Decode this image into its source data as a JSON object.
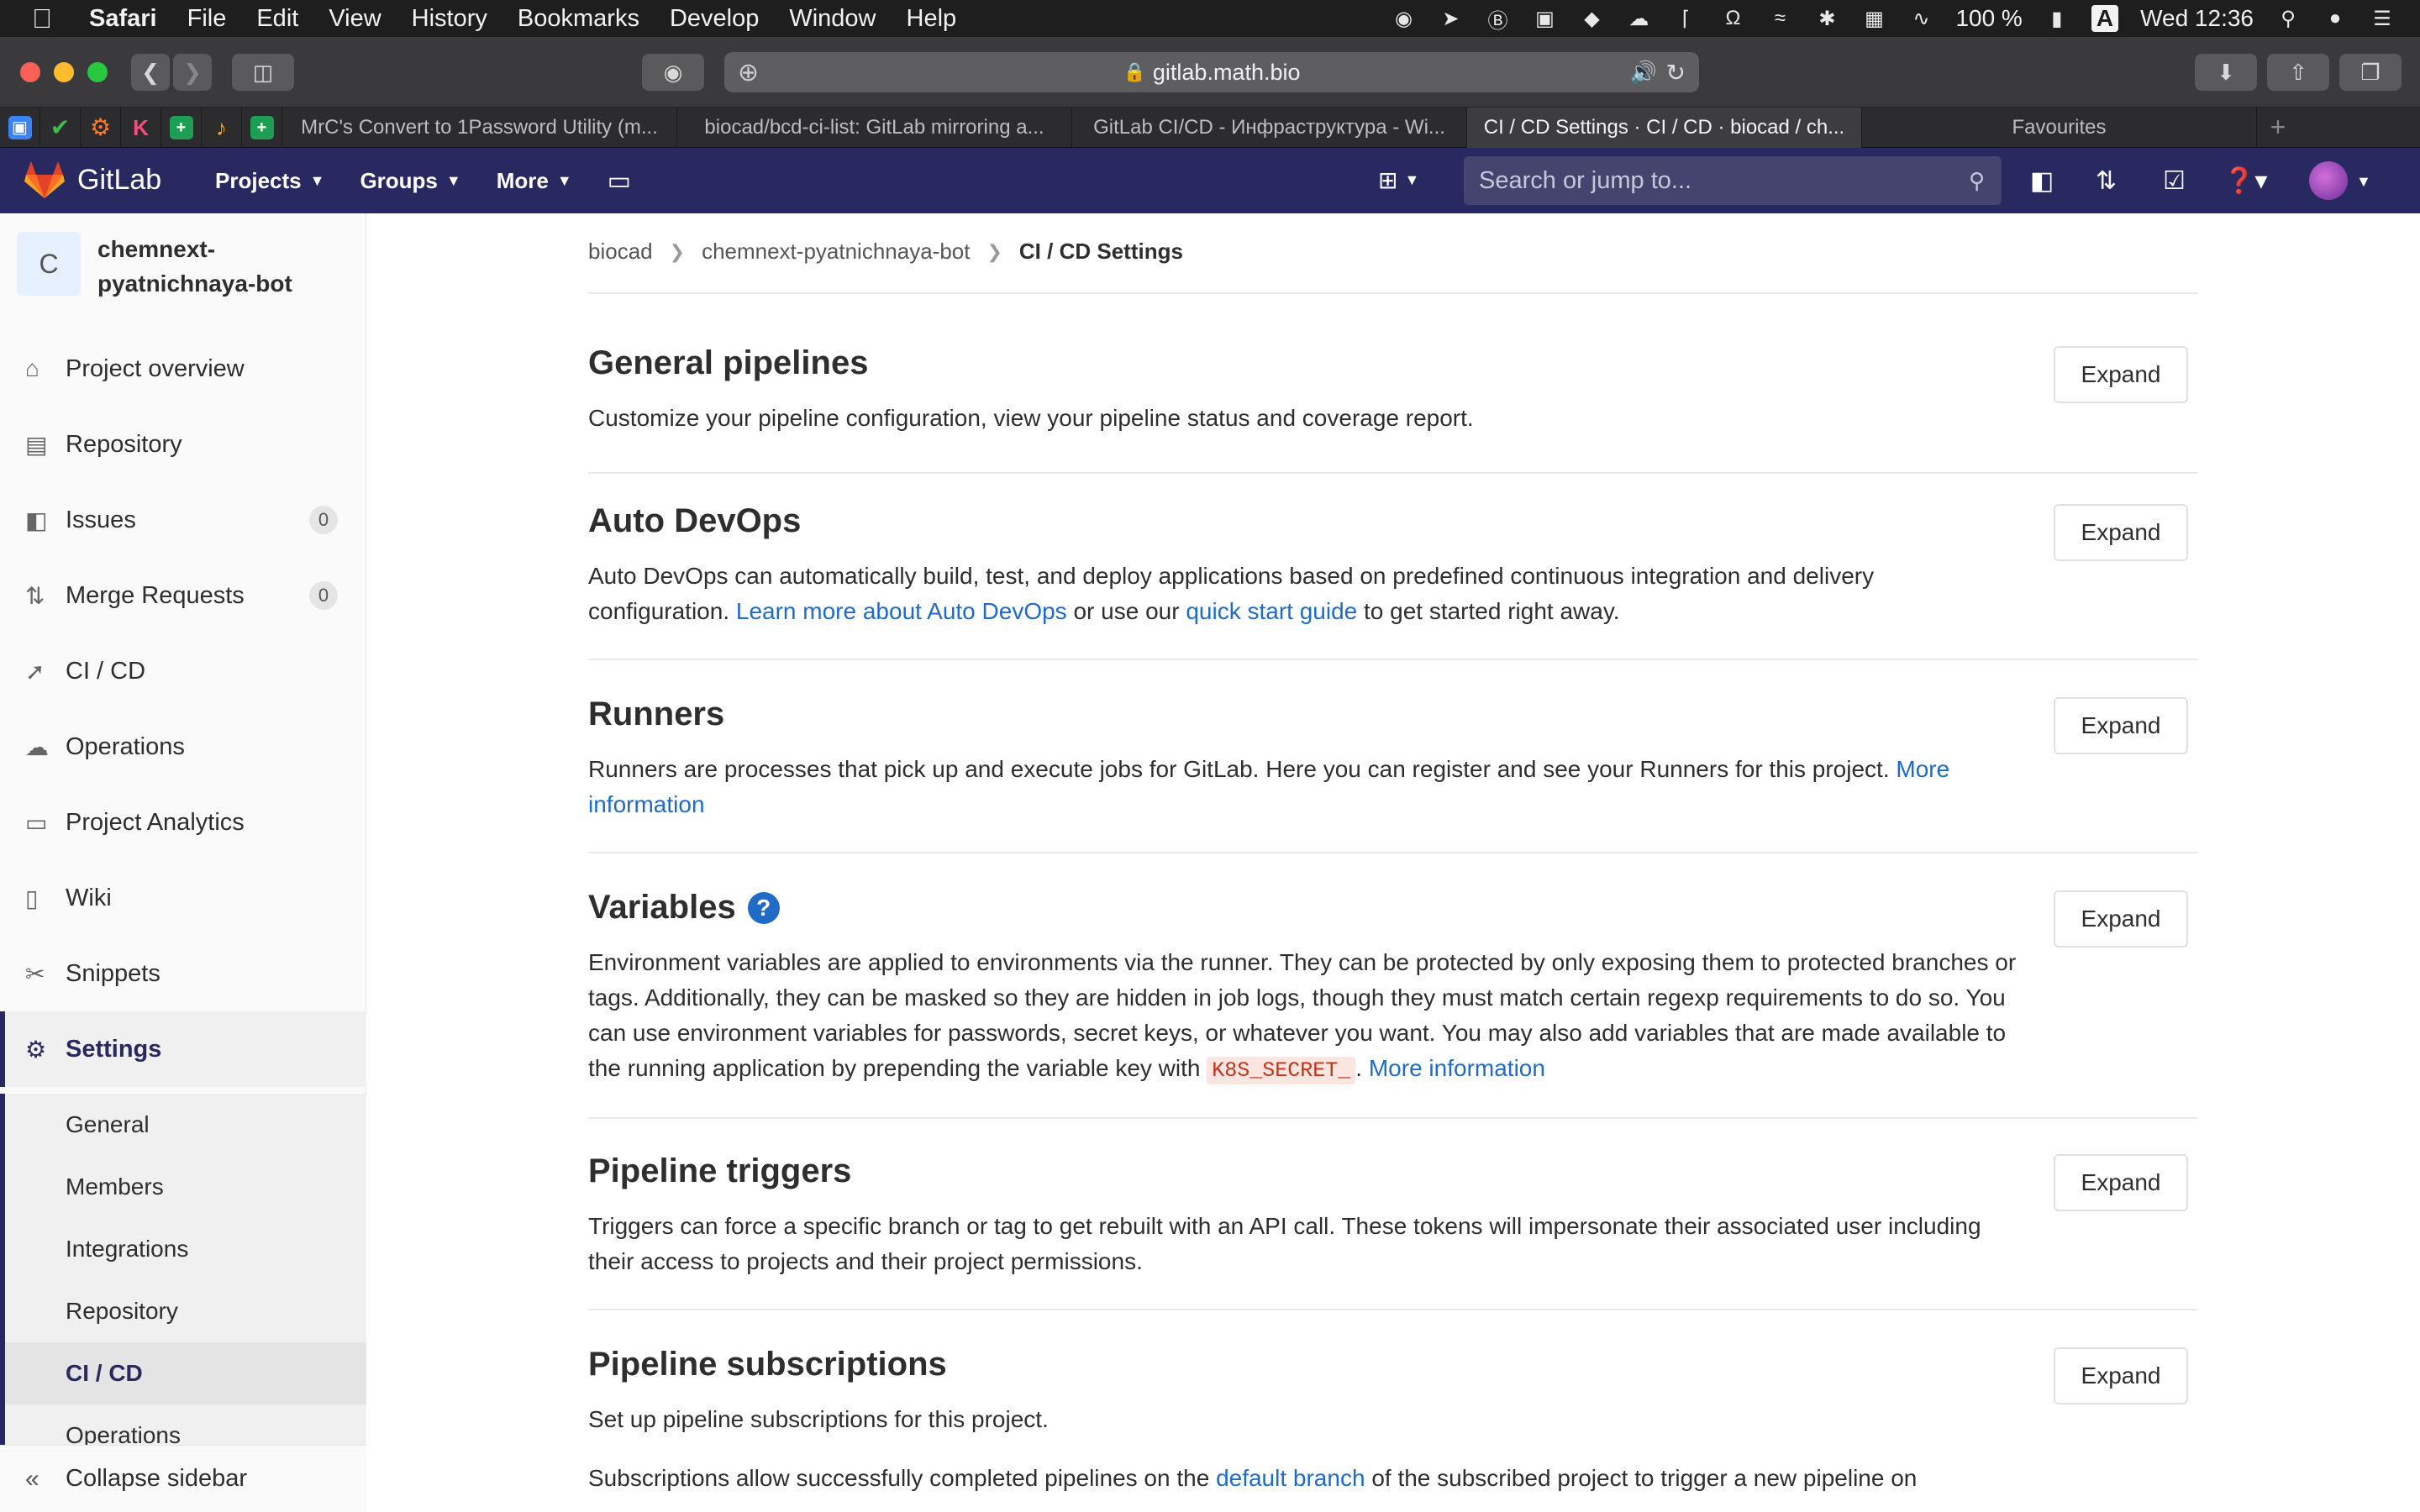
{
  "menubar": {
    "app": "Safari",
    "items": [
      "File",
      "Edit",
      "View",
      "History",
      "Bookmarks",
      "Develop",
      "Window",
      "Help"
    ],
    "battery": "100 %",
    "input_source": "A",
    "clock": "Wed 12:36"
  },
  "toolbar": {
    "url": "gitlab.math.bio"
  },
  "tabs": {
    "items": [
      "MrC's Convert to 1Password Utility (m...",
      "biocad/bcd-ci-list: GitLab mirroring a...",
      "GitLab CI/CD - Инфраструктура - Wi...",
      "CI / CD Settings · CI / CD · biocad / ch...",
      "Favourites"
    ]
  },
  "gitlab": {
    "brand": "GitLab",
    "nav": [
      "Projects",
      "Groups",
      "More"
    ],
    "search_placeholder": "Search or jump to...",
    "colors": {
      "header": "#292961",
      "link": "#1f6bc6"
    }
  },
  "sidebar": {
    "project_initial": "C",
    "project_name": "chemnext-pyatnichnaya-bot",
    "items": [
      {
        "label": "Project overview",
        "icon": "home-icon"
      },
      {
        "label": "Repository",
        "icon": "book-icon"
      },
      {
        "label": "Issues",
        "icon": "issues-icon",
        "badge": "0"
      },
      {
        "label": "Merge Requests",
        "icon": "merge-request-icon",
        "badge": "0"
      },
      {
        "label": "CI / CD",
        "icon": "rocket-icon"
      },
      {
        "label": "Operations",
        "icon": "cloud-gear-icon"
      },
      {
        "label": "Project Analytics",
        "icon": "chart-icon"
      },
      {
        "label": "Wiki",
        "icon": "wiki-icon"
      },
      {
        "label": "Snippets",
        "icon": "scissors-icon"
      },
      {
        "label": "Settings",
        "icon": "gear-icon"
      }
    ],
    "sub_items": [
      "General",
      "Members",
      "Integrations",
      "Repository",
      "CI / CD",
      "Operations"
    ],
    "collapse_label": "Collapse sidebar"
  },
  "breadcrumb": {
    "items": [
      "biocad",
      "chemnext-pyatnichnaya-bot",
      "CI / CD Settings"
    ]
  },
  "expand_label": "Expand",
  "sections": {
    "general": {
      "title": "General pipelines",
      "text": "Customize your pipeline configuration, view your pipeline status and coverage report."
    },
    "autodevops": {
      "title": "Auto DevOps",
      "text1": "Auto DevOps can automatically build, test, and deploy applications based on predefined continuous integration and delivery configuration.",
      "link1": "Learn more about Auto DevOps",
      "text2": "or use our",
      "link2": "quick start guide",
      "text3": "to get started right away."
    },
    "runners": {
      "title": "Runners",
      "text": "Runners are processes that pick up and execute jobs for GitLab. Here you can register and see your Runners for this project.",
      "link": "More information"
    },
    "variables": {
      "title": "Variables",
      "text": "Environment variables are applied to environments via the runner. They can be protected by only exposing them to protected branches or tags. Additionally, they can be masked so they are hidden in job logs, though they must match certain regexp requirements to do so. You can use environment variables for passwords, secret keys, or whatever you want. You may also add variables that are made available to the running application by prepending the variable key with",
      "code": "K8S_SECRET_",
      "link": "More information"
    },
    "triggers": {
      "title": "Pipeline triggers",
      "text": "Triggers can force a specific branch or tag to get rebuilt with an API call. These tokens will impersonate their associated user including their access to projects and their project permissions."
    },
    "subscriptions": {
      "title": "Pipeline subscriptions",
      "text": "Set up pipeline subscriptions for this project.",
      "text2": "Subscriptions allow successfully completed pipelines on the",
      "link": "default branch",
      "text3": "of the subscribed project to trigger a new pipeline on"
    }
  }
}
